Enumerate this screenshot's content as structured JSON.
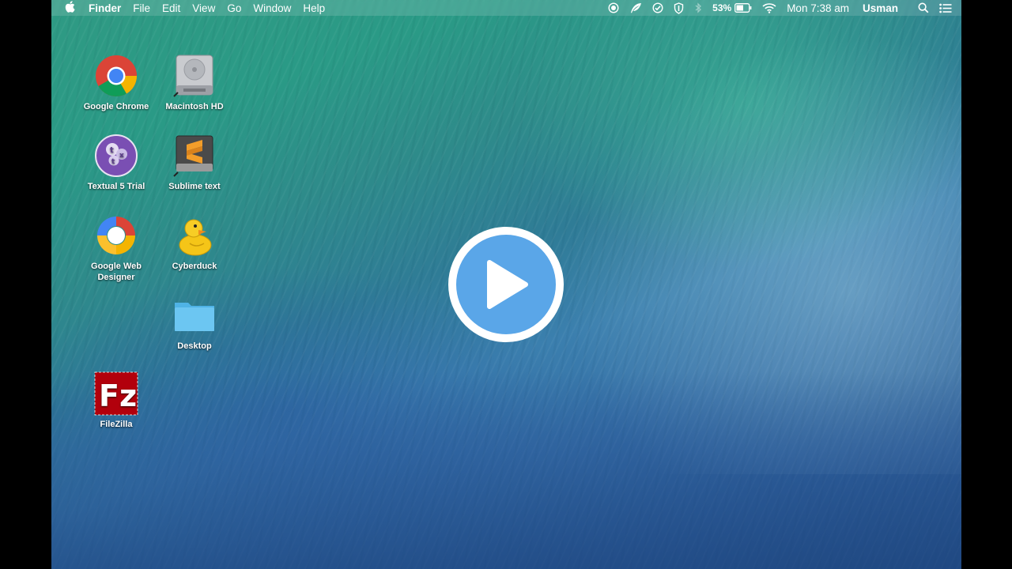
{
  "menubar": {
    "apple_icon": "apple-icon",
    "app_name": "Finder",
    "menus": [
      "File",
      "Edit",
      "View",
      "Go",
      "Window",
      "Help"
    ],
    "battery_percent": "53%",
    "clock": "Mon 7:38 am",
    "user": "Usman"
  },
  "desktop": {
    "icons": [
      {
        "label": "Google Chrome"
      },
      {
        "label": "Macintosh HD"
      },
      {
        "label": "Textual 5 Trial"
      },
      {
        "label": "Sublime text"
      },
      {
        "label": "Google Web Designer"
      },
      {
        "label": "Cyberduck"
      },
      {
        "label": "Desktop"
      },
      {
        "label": "FileZilla"
      }
    ]
  },
  "overlay": {
    "play_icon": "play-icon",
    "accent": "#5aa6e8"
  }
}
